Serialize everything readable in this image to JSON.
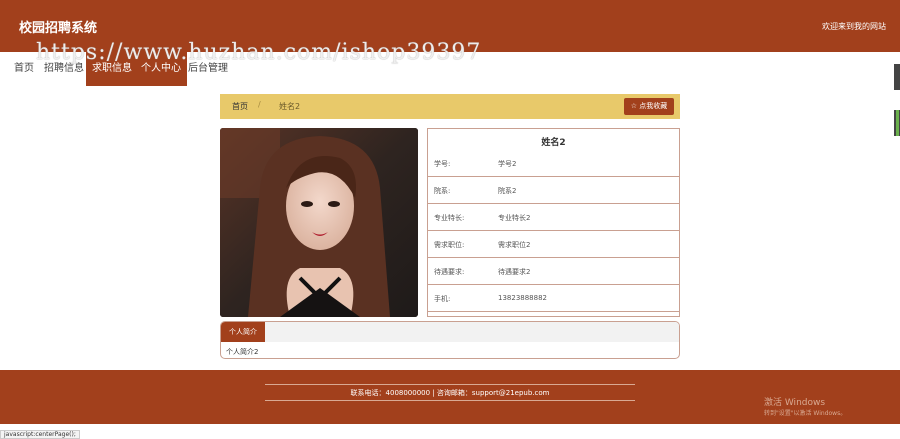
{
  "header": {
    "site_title": "校园招聘系统",
    "welcome": "欢迎来到我的网站"
  },
  "watermark": "https://www.huzhan.com/ishop39397",
  "nav": {
    "items": [
      {
        "label": "首页",
        "active": false
      },
      {
        "label": "招聘信息",
        "active": false
      },
      {
        "label": "求职信息",
        "active": true
      },
      {
        "label": "个人中心",
        "active": true
      },
      {
        "label": "后台管理",
        "active": false
      }
    ]
  },
  "breadcrumb": {
    "home": "首页",
    "separator": "/",
    "current": "姓名2",
    "favorite_label": "点我收藏",
    "favorite_icon": "star-icon"
  },
  "profile": {
    "name": "姓名2",
    "fields": [
      {
        "label": "学号:",
        "value": "学号2"
      },
      {
        "label": "院系:",
        "value": "院系2"
      },
      {
        "label": "专业特长:",
        "value": "专业特长2"
      },
      {
        "label": "需求职位:",
        "value": "需求职位2"
      },
      {
        "label": "待遇要求:",
        "value": "待遇要求2"
      },
      {
        "label": "手机:",
        "value": "13823888882"
      }
    ]
  },
  "intro": {
    "tab_label": "个人简介",
    "text": "个人简介2"
  },
  "footer": {
    "contact": "联系电话：4008000000 | 咨询邮箱：support@21epub.com"
  },
  "windows_activation": {
    "title": "激活 Windows",
    "subtitle": "转到\"设置\"以激活 Windows。"
  },
  "status_bar": "javascript:centerPage();",
  "colors": {
    "brand": "#a2401c",
    "breadcrumb_bg": "#e8c96a"
  }
}
